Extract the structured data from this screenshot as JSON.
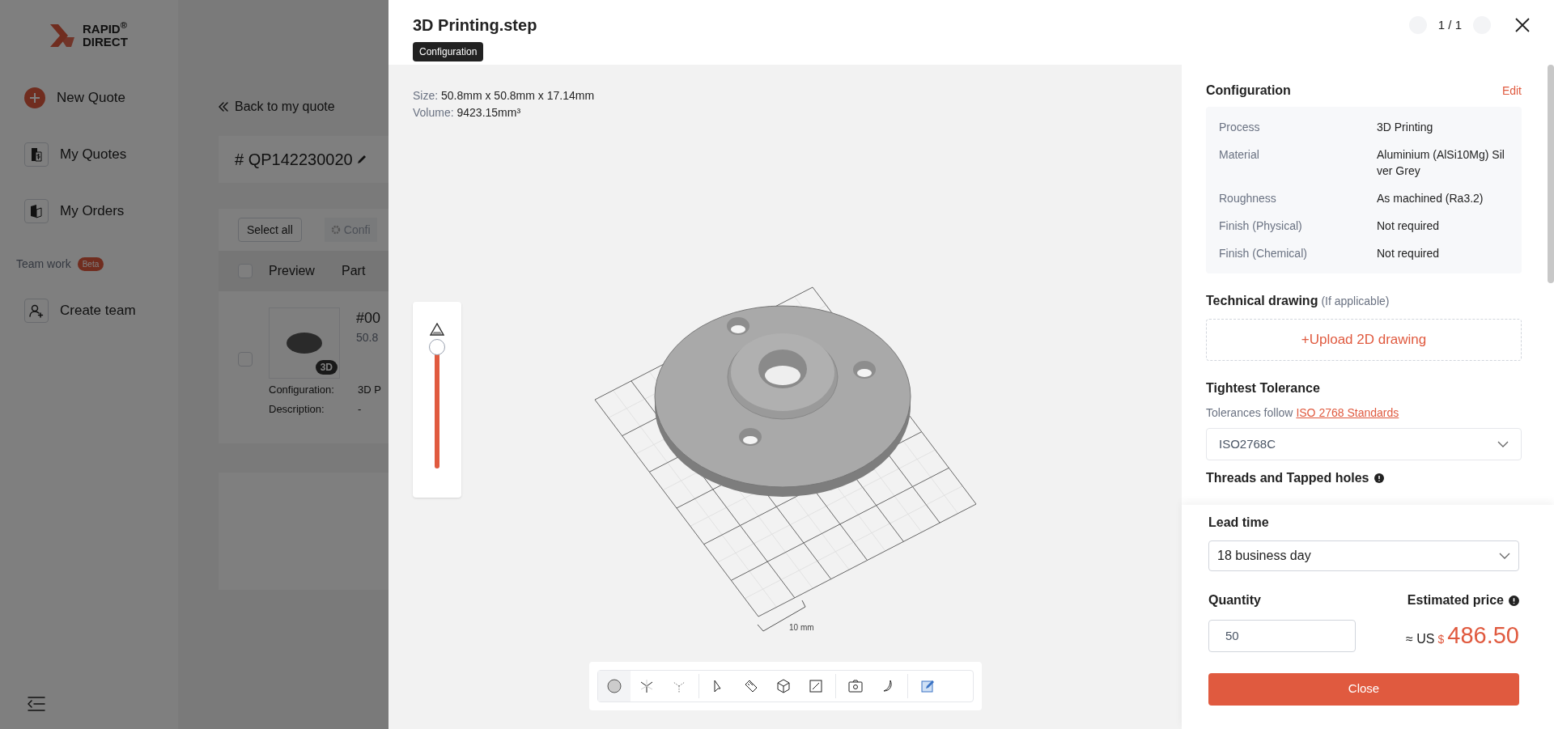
{
  "logo": {
    "text_1": "RAPID$^{®}$",
    "text_2": "DIRECT"
  },
  "sidebar": {
    "items": [
      {
        "label": "New Quote"
      },
      {
        "label": "My Quotes"
      },
      {
        "label": "My Orders"
      }
    ],
    "section": {
      "label": "Team work",
      "badge": "Beta"
    },
    "team_items": [
      {
        "label": "Create team"
      }
    ]
  },
  "page": {
    "back_link": "Back to my quote",
    "quote_number": "# QP142230020",
    "toolbar": {
      "select_all": "Select all",
      "configure": "Confi"
    },
    "table": {
      "header": {
        "checked": false,
        "columns": [
          "Preview",
          "Part"
        ]
      },
      "rows": [
        {
          "checked": false,
          "badge": "3D",
          "part_number": "#00",
          "size": "50.8",
          "config_label": "Configuration:",
          "config_value": "3D P",
          "description_label": "Description:",
          "description_value": "-"
        }
      ]
    }
  },
  "modal": {
    "title": "3D Printing.step",
    "tag": "Configuration",
    "pager": "1 / 1",
    "viewer": {
      "size_label": "Size:",
      "size_value": "50.8mm x 50.8mm x 17.14mm",
      "volume_label": "Volume:",
      "volume_value": "9423.15mm³",
      "clipping_slider": {
        "level": 1
      },
      "scale_label": "10 mm",
      "tool_groups": [
        [
          {
            "selected": true
          },
          {
            "selected": false
          },
          {
            "selected": false
          }
        ],
        [
          {
            "selected": false
          },
          {
            "selected": false
          },
          {
            "selected": false
          },
          {
            "selected": false
          }
        ],
        [
          {
            "selected": false
          },
          {
            "selected": false
          }
        ],
        [
          {
            "selected": false
          }
        ]
      ]
    },
    "configuration": {
      "title": "Configuration",
      "edit": "Edit",
      "rows": [
        {
          "label": "Process",
          "value": "3D Printing"
        },
        {
          "label": "Material",
          "value": "Aluminium (AlSi10Mg) Silver Grey"
        },
        {
          "label": "Roughness",
          "value": "As machined (Ra3.2)"
        },
        {
          "label": "Finish (Physical)",
          "value": "Not required"
        },
        {
          "label": "Finish (Chemical)",
          "value": "Not required"
        }
      ]
    },
    "technical_drawing": {
      "title": "Technical drawing",
      "note": "(If applicable)",
      "upload": "+Upload 2D drawing"
    },
    "tolerance": {
      "title": "Tightest Tolerance",
      "note": "Tolerances follow",
      "link": "ISO 2768 Standards",
      "value": "ISO2768C"
    },
    "threads": {
      "title": "Threads and Tapped holes"
    },
    "lead_time": {
      "title": "Lead time",
      "value": "18 business day"
    },
    "quantity": {
      "title": "Quantity",
      "value": "50"
    },
    "price": {
      "title": "Estimated price",
      "prefix": "≈ US",
      "currency": "$",
      "amount": "486.50"
    },
    "close": "Close"
  }
}
